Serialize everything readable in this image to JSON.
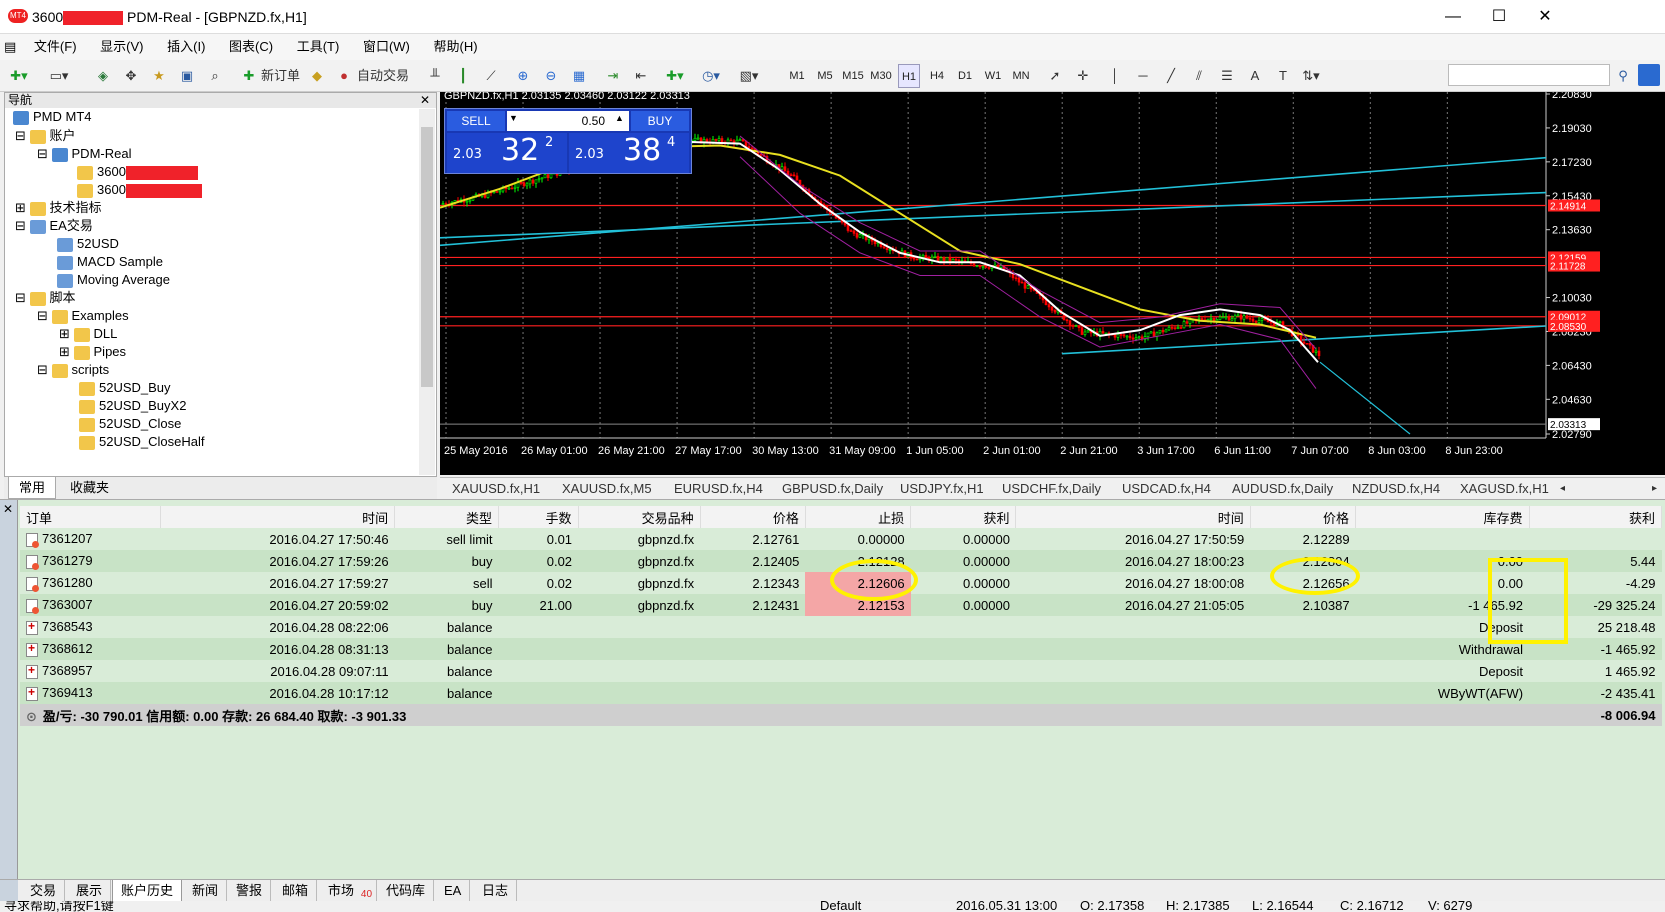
{
  "window": {
    "title_prefix": "3600",
    "title_suffix": "PDM-Real - [GBPNZD.fx,H1]",
    "app_icon": "MT4",
    "minimize": "—",
    "maximize": "☐",
    "close": "✕"
  },
  "menu": [
    "文件(F)",
    "显示(V)",
    "插入(I)",
    "图表(C)",
    "工具(T)",
    "窗口(W)",
    "帮助(H)"
  ],
  "toolbar": {
    "new_order": "新订单",
    "auto_trade": "自动交易",
    "timeframes": [
      "M1",
      "M5",
      "M15",
      "M30",
      "H1",
      "H4",
      "D1",
      "W1",
      "MN"
    ]
  },
  "navigator": {
    "title": "导航",
    "close": "✕",
    "items": [
      {
        "label": "PMD MT4"
      },
      {
        "label": "账户"
      },
      {
        "label": "PDM-Real"
      },
      {
        "label": "3600"
      },
      {
        "label": "3600"
      },
      {
        "label": "技术指标"
      },
      {
        "label": "EA交易"
      },
      {
        "label": "52USD"
      },
      {
        "label": "MACD Sample"
      },
      {
        "label": "Moving Average"
      },
      {
        "label": "脚本"
      },
      {
        "label": "Examples"
      },
      {
        "label": "DLL"
      },
      {
        "label": "Pipes"
      },
      {
        "label": "scripts"
      },
      {
        "label": "52USD_Buy"
      },
      {
        "label": "52USD_BuyX2"
      },
      {
        "label": "52USD_Close"
      },
      {
        "label": "52USD_CloseHalf"
      }
    ],
    "tabs": [
      "常用",
      "收藏夹"
    ]
  },
  "chart": {
    "header": "GBPNZD.fx,H1  2.03135 2.03460 2.03122 2.03313",
    "sell_label": "SELL",
    "buy_label": "BUY",
    "lot": "0.50",
    "sell_price_prefix": "2.03",
    "sell_price_big": "32",
    "sell_price_sup": "2",
    "buy_price_prefix": "2.03",
    "buy_price_big": "38",
    "buy_price_sup": "4",
    "price_axis": [
      "2.20830",
      "2.19030",
      "2.17230",
      "2.15430",
      "2.13630",
      "2.10030",
      "2.08230",
      "2.06430",
      "2.04630",
      "2.02790"
    ],
    "price_tags": [
      "2.14914",
      "2.12159",
      "2.11728",
      "2.09012",
      "2.08530",
      "2.03313"
    ],
    "time_axis": [
      "25 May 2016",
      "26 May 01:00",
      "26 May 21:00",
      "27 May 17:00",
      "30 May 13:00",
      "31 May 09:00",
      "1 Jun 05:00",
      "2 Jun 01:00",
      "2 Jun 21:00",
      "3 Jun 17:00",
      "6 Jun 11:00",
      "7 Jun 07:00",
      "8 Jun 03:00",
      "8 Jun 23:00"
    ],
    "colors": {
      "bg": "#000000",
      "up": "#00ff00",
      "down": "#ff0000",
      "ma_fast": "#ffffff",
      "ma_slow": "#e8e020",
      "trend": "#22c0d8",
      "levels": "#ff2020"
    }
  },
  "chart_tabs": [
    "XAUUSD.fx,H1",
    "XAUUSD.fx,M5",
    "EURUSD.fx,H4",
    "GBPUSD.fx,Daily",
    "USDJPY.fx,H1",
    "USDCHF.fx,Daily",
    "USDCAD.fx,H4",
    "AUDUSD.fx,Daily",
    "NZDUSD.fx,H4",
    "XAGUSD.fx,H1"
  ],
  "history": {
    "columns": [
      "订单",
      "时间",
      "类型",
      "手数",
      "交易品种",
      "价格",
      "止损",
      "获利",
      "时间",
      "价格",
      "库存费",
      "获利"
    ],
    "rows": [
      {
        "order": "7361207",
        "open_time": "2016.04.27 17:50:46",
        "type": "sell limit",
        "lots": "0.01",
        "symbol": "gbpnzd.fx",
        "price": "2.12761",
        "sl": "0.00000",
        "tp": "0.00000",
        "close_time": "2016.04.27 17:50:59",
        "close_price": "2.12289",
        "swap": "",
        "profit": ""
      },
      {
        "order": "7361279",
        "open_time": "2016.04.27 17:59:26",
        "type": "buy",
        "lots": "0.02",
        "symbol": "gbpnzd.fx",
        "price": "2.12405",
        "sl": "2.12128",
        "tp": "0.00000",
        "close_time": "2016.04.27 18:00:23",
        "close_price": "2.12804",
        "swap": "0.00",
        "profit": "5.44"
      },
      {
        "order": "7361280",
        "open_time": "2016.04.27 17:59:27",
        "type": "sell",
        "lots": "0.02",
        "symbol": "gbpnzd.fx",
        "price": "2.12343",
        "sl": "2.12606",
        "tp": "0.00000",
        "close_time": "2016.04.27 18:00:08",
        "close_price": "2.12656",
        "swap": "0.00",
        "profit": "-4.29"
      },
      {
        "order": "7363007",
        "open_time": "2016.04.27 20:59:02",
        "type": "buy",
        "lots": "21.00",
        "symbol": "gbpnzd.fx",
        "price": "2.12431",
        "sl": "2.12153",
        "tp": "0.00000",
        "close_time": "2016.04.27 21:05:05",
        "close_price": "2.10387",
        "swap": "-1 465.92",
        "profit": "-29 325.24"
      },
      {
        "order": "7368543",
        "open_time": "2016.04.28 08:22:06",
        "type": "balance",
        "lots": "",
        "symbol": "",
        "price": "",
        "sl": "",
        "tp": "",
        "close_time": "",
        "close_price": "",
        "swap": "Deposit",
        "profit": "25 218.48"
      },
      {
        "order": "7368612",
        "open_time": "2016.04.28 08:31:13",
        "type": "balance",
        "lots": "",
        "symbol": "",
        "price": "",
        "sl": "",
        "tp": "",
        "close_time": "",
        "close_price": "",
        "swap": "Withdrawal",
        "profit": "-1 465.92"
      },
      {
        "order": "7368957",
        "open_time": "2016.04.28 09:07:11",
        "type": "balance",
        "lots": "",
        "symbol": "",
        "price": "",
        "sl": "",
        "tp": "",
        "close_time": "",
        "close_price": "",
        "swap": "Deposit",
        "profit": "1 465.92"
      },
      {
        "order": "7369413",
        "open_time": "2016.04.28 10:17:12",
        "type": "balance",
        "lots": "",
        "symbol": "",
        "price": "",
        "sl": "",
        "tp": "",
        "close_time": "",
        "close_price": "",
        "swap": "WByWT(AFW)",
        "profit": "-2 435.41"
      }
    ],
    "summary": "盈/亏: -30 790.01  信用额: 0.00  存款: 26 684.40  取款: -3 901.33",
    "summary_total": "-8 006.94"
  },
  "terminal_tabs": [
    "交易",
    "展示",
    "账户历史",
    "新闻",
    "警报",
    "邮箱",
    "市场",
    "代码库",
    "EA",
    "日志"
  ],
  "market_badge": "40",
  "status": {
    "help": "寻求帮助,请按F1键",
    "profile": "Default",
    "datetime": "2016.05.31 13:00",
    "open": "O: 2.17358",
    "high": "H: 2.17385",
    "low": "L: 2.16544",
    "close": "C: 2.16712",
    "volume": "V: 6279"
  }
}
